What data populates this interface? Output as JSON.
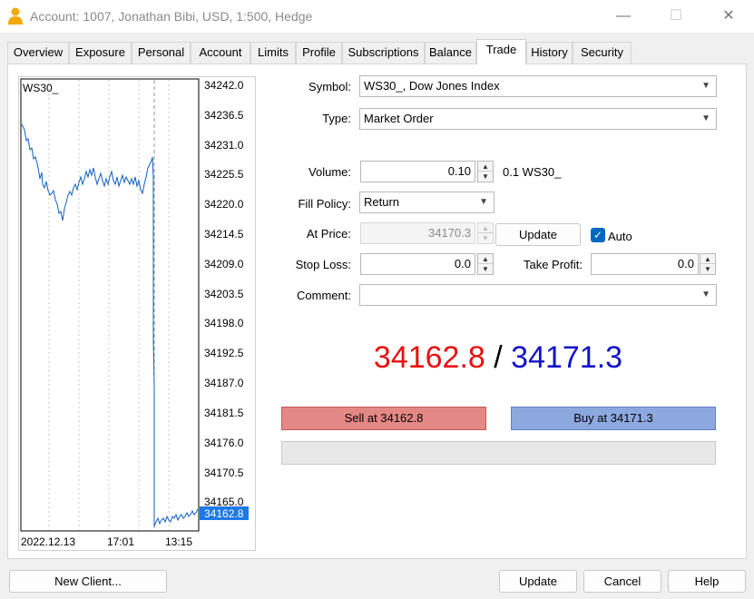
{
  "window": {
    "title": "Account: 1007, Jonathan Bibi, USD, 1:500, Hedge",
    "icon": "user-icon",
    "controls": [
      "minimize-icon",
      "maximize-icon",
      "close-icon"
    ]
  },
  "tabs": [
    {
      "label": "Overview"
    },
    {
      "label": "Exposure"
    },
    {
      "label": "Personal"
    },
    {
      "label": "Account"
    },
    {
      "label": "Limits"
    },
    {
      "label": "Profile"
    },
    {
      "label": "Subscriptions"
    },
    {
      "label": "Balance"
    },
    {
      "label": "Trade",
      "active": true
    },
    {
      "label": "History"
    },
    {
      "label": "Security"
    }
  ],
  "chart": {
    "symbol": "WS30_",
    "y_ticks": [
      "34242.0",
      "34236.5",
      "34231.0",
      "34225.5",
      "34220.0",
      "34214.5",
      "34209.0",
      "34203.5",
      "34198.0",
      "34192.5",
      "34187.0",
      "34181.5",
      "34176.0",
      "34170.5",
      "34165.0"
    ],
    "current_price": "34162.8",
    "x_ticks": [
      "2022.12.13",
      "17:01",
      "13:15"
    ],
    "line_color": "#1060c0",
    "price_tag_color": "#1e78e6"
  },
  "form": {
    "symbol_label": "Symbol:",
    "symbol_value": "WS30_, Dow Jones Index",
    "type_label": "Type:",
    "type_value": "Market Order",
    "volume_label": "Volume:",
    "volume_value": "0.10",
    "volume_hint": "0.1 WS30_",
    "fill_policy_label": "Fill Policy:",
    "fill_policy_value": "Return",
    "at_price_label": "At Price:",
    "at_price_value": "34170.3",
    "update_price_button": "Update",
    "auto_label": "Auto",
    "auto_checked": true,
    "stop_loss_label": "Stop Loss:",
    "stop_loss_value": "0.0",
    "take_profit_label": "Take Profit:",
    "take_profit_value": "0.0",
    "comment_label": "Comment:",
    "comment_value": ""
  },
  "quote": {
    "bid": "34162.8",
    "separator": "/",
    "ask": "34171.3",
    "bid_color": "#e81010",
    "ask_color": "#1414c8"
  },
  "actions": {
    "sell_label": "Sell at 34162.8",
    "buy_label": "Buy at 34171.3"
  },
  "footer": {
    "new_client": "New Client...",
    "update": "Update",
    "cancel": "Cancel",
    "help": "Help"
  }
}
